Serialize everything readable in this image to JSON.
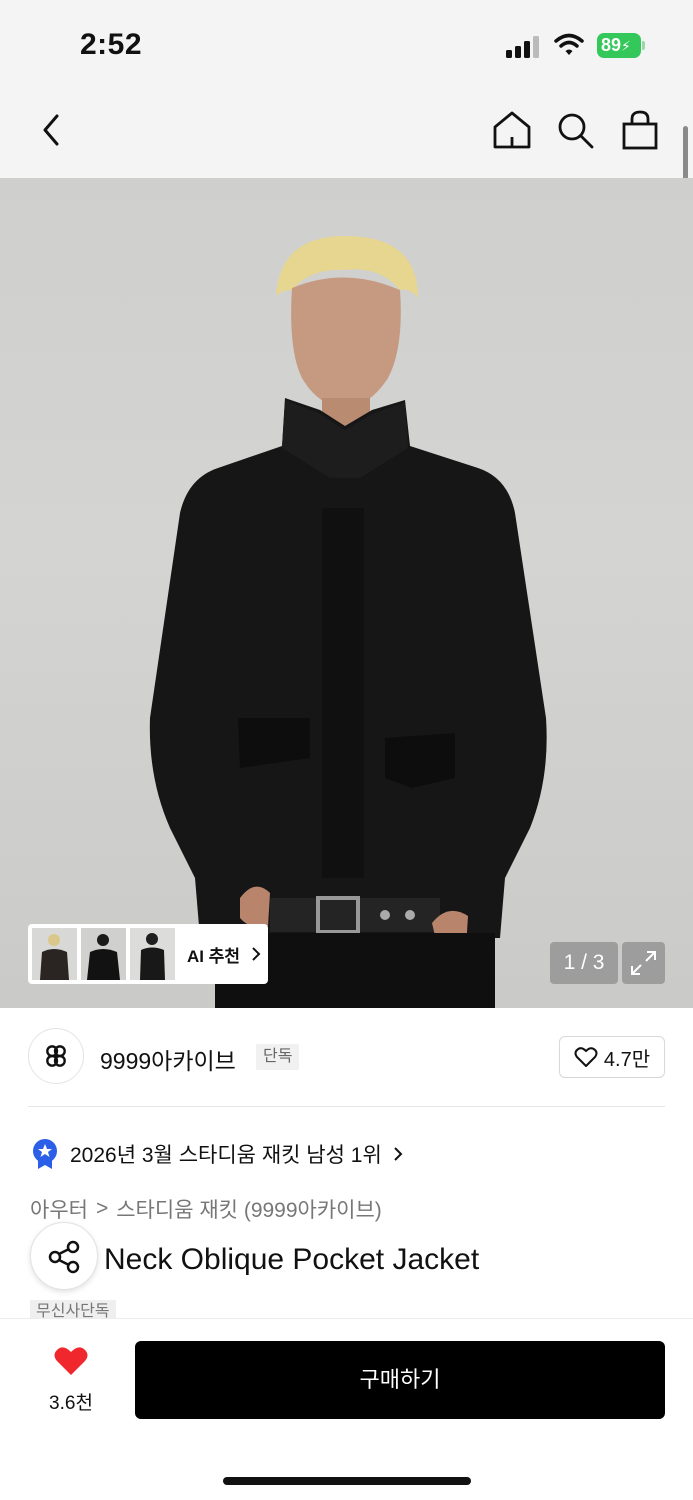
{
  "status_bar": {
    "time": "2:52",
    "battery": "89"
  },
  "nav": {
    "back_icon": "chevron-left-icon",
    "home_icon": "home-icon",
    "search_icon": "search-icon",
    "cart_icon": "shopping-bag-icon"
  },
  "gallery": {
    "ai_label": "AI 추천",
    "page_counter": "1 / 3",
    "current_page": 1,
    "total_pages": 3
  },
  "brand": {
    "name": "9999아카이브",
    "badge": "단독",
    "likes": "4.7만"
  },
  "ranking": {
    "text": "2026년 3월 스타디움 재킷 남성 1위"
  },
  "breadcrumb": {
    "category": "아우터",
    "separator": ">",
    "subcategory": "스타디움 재킷 (9999아카이브)"
  },
  "product": {
    "title": "Neck Oblique Pocket Jacket",
    "badge": "무신사단독"
  },
  "bottom": {
    "like_count": "3.6천",
    "buy_label": "구매하기"
  },
  "colors": {
    "accent_red": "#f0282d",
    "battery_green": "#34c759",
    "ranking_blue": "#2b5fe8",
    "buy_black": "#000000"
  }
}
